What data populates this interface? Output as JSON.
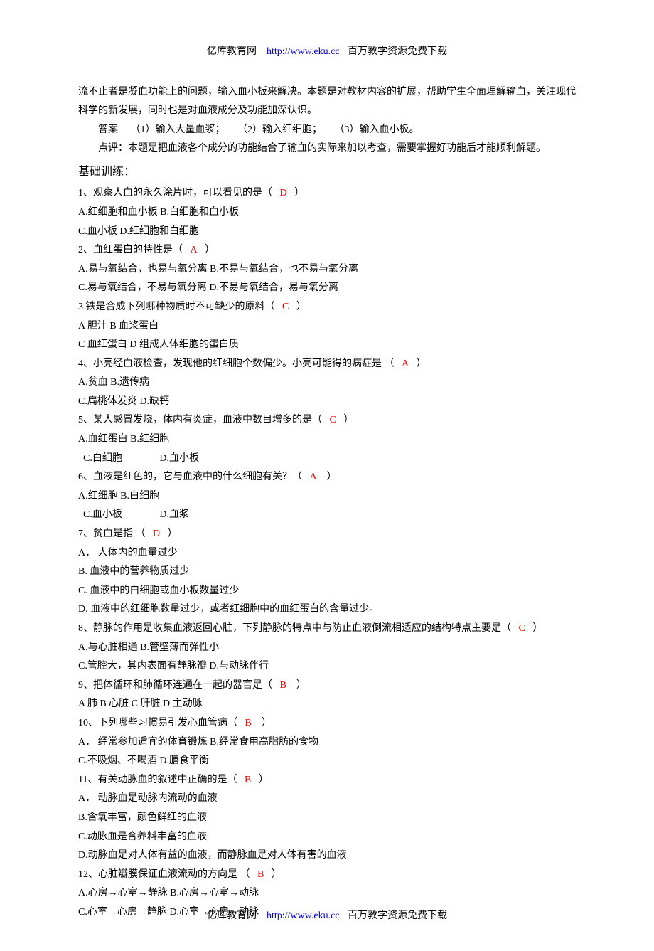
{
  "header": {
    "brand": "亿库教育网",
    "url": "http://www.eku.cc",
    "slogan": "百万教学资源免费下载"
  },
  "intro": {
    "p1": "流不止者是凝血功能上的问题，输入血小板来解决。本题是对教材内容的扩展，帮助学生全面理解输血，关注现代科学的新发展，同时也是对血液成分及功能加深认识。",
    "p2a": "答案",
    "p2b": "（1）输入大量血浆；",
    "p2c": "（2）输入红细胞；",
    "p2d": "（3）输入血小板。",
    "p3": "点评：本题是把血液各个成分的功能结合了输血的实际来加以考查，需要掌握好功能后才能顺利解题。"
  },
  "section_title": "基础训练：",
  "q1": {
    "stem": "1、观察人血的永久涂片时，可以看见的是（",
    "ans": "D",
    "close": "）",
    "opts1": "A.红细胞和血小板          B.白细胞和血小板",
    "opts2": "C.血小板               D.红细胞和白细胞"
  },
  "q2": {
    "stem": "2、血红蛋白的特性是（",
    "ans": "A",
    "close": "）",
    "opts1": "A.易与氧结合，也易与氧分离                   B.不易与氧结合，也不易与氧分离",
    "opts2": "C.易与氧结合，不易与氧分离                   D.不易与氧结合，易与氧分离"
  },
  "q3": {
    "stem": "3 铁是合成下列哪种物质时不可缺少的原料（",
    "ans": "C",
    "close": "）",
    "opts1": "A 胆汁                          B 血浆蛋白",
    "opts2": "C 血红蛋白                      D 组成人体细胞的蛋白质"
  },
  "q4": {
    "stem": "4、小亮经血液检查，发现他的红细胞个数偏少。小亮可能得的病症是        （",
    "ans": "A",
    "close": "）",
    "opts1": "A.贫血            B.遗传病",
    "opts2": "C.扁桃体发炎               D.缺钙"
  },
  "q5": {
    "stem": "5、某人感冒发烧，体内有炎症，血液中数目增多的是（",
    "ans": "C",
    "close": "）",
    "opts1": "A.血红蛋白                    B.红细胞",
    "opts2": "  C.白细胞               D.血小板"
  },
  "q6": {
    "stem": "6、血液是红色的，它与血液中的什么细胞有关？（",
    "ans": "A",
    "close": "）",
    "opts1": "A.红细胞                    B.白细胞",
    "opts2": "  C.血小板               D.血浆"
  },
  "q7": {
    "stem": "7、贫血是指          （",
    "ans": "D",
    "close": "）",
    "a": "A．  人体内的血量过少",
    "b": "B. 血液中的营养物质过少",
    "c": "C. 血液中的白细胞或血小板数量过少",
    "d": "D. 血液中的红细胞数量过少，或者红细胞中的血红蛋白的含量过少。"
  },
  "q8": {
    "stem": "8、静脉的作用是收集血液返回心脏，下列静脉的特点中与防止血液倒流相适应的结构特点主要是（",
    "ans": "C",
    "close": "）",
    "opts1": "A.与心脏相通                                B.管壁薄而弹性小",
    "opts2": "C.管腔大，其内表面有静脉瓣           D.与动脉伴行"
  },
  "q9": {
    "stem": "9、把体循环和肺循环连通在一起的器官是（",
    "ans": "B",
    "close": "）",
    "opts1": "A 肺                      B 心脏                     C 肝脏                    D 主动脉"
  },
  "q10": {
    "stem": "10、下列哪些习惯易引发心血管病（",
    "ans": "B",
    "close": "）",
    "opts1": "A．  经常参加适宜的体育锻炼                B.经常食用高脂肪的食物",
    "opts2": "C.不吸烟、不喝酒                                   D.膳食平衡"
  },
  "q11": {
    "stem": "11、有关动脉血的叙述中正确的是（",
    "ans": "B",
    "close": "）",
    "a": "A．  动脉血是动脉内流动的血液",
    "b": "B.含氧丰富，颜色鲜红的血液",
    "c": "C.动脉血是含养料丰富的血液",
    "d": "D.动脉血是对人体有益的血液，而静脉血是对人体有害的血液"
  },
  "q12": {
    "stem": "12、心脏瓣膜保证血液流动的方向是  （",
    "ans": "B",
    "close": "）",
    "opts1": "A.心房→心室→静脉         B.心房→心室→动脉",
    "opts2": "C.心室→心房→静脉          D.心室→心房→动脉"
  }
}
